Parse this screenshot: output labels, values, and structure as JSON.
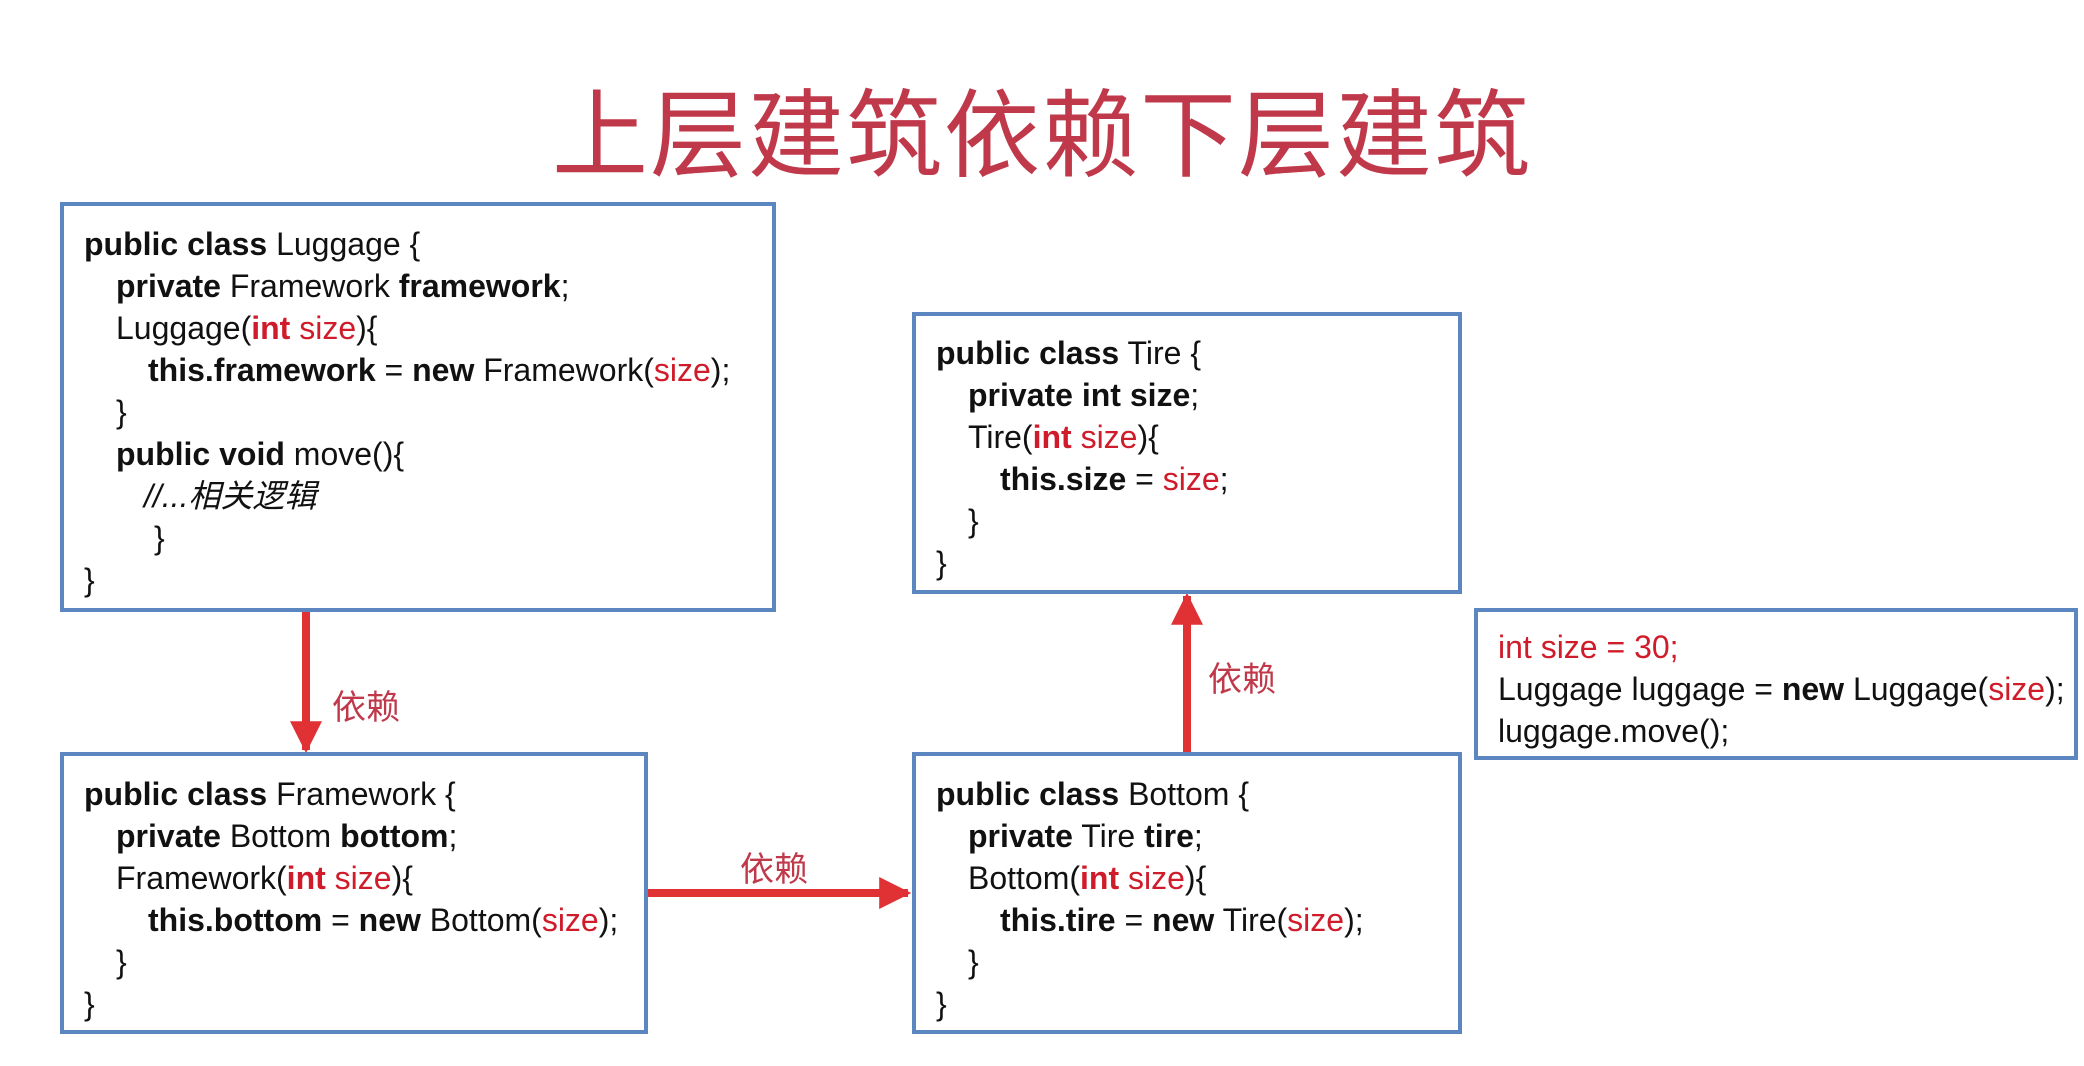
{
  "title": "上层建筑依赖下层建筑",
  "colors": {
    "title": "#c0394b",
    "keyword_red": "#d01c2a",
    "box_border": "#5b86c0",
    "arrow": "#e03134"
  },
  "arrow_label": "依赖",
  "boxes": {
    "luggage": {
      "l1": {
        "a": "public class",
        "b": " Luggage {"
      },
      "l2": {
        "a": "private",
        "b": " Framework ",
        "c": "framework",
        "d": ";"
      },
      "l3": {
        "a": "Luggage(",
        "b": "int",
        "c": " size",
        "d": "){"
      },
      "l4": {
        "a": "this.framework",
        "b": " = ",
        "c": "new",
        "d": " Framework(",
        "e": "size",
        "f": ");"
      },
      "l5": "}",
      "l6": {
        "a": "public void",
        "b": " move(){"
      },
      "l7": "//...相关逻辑",
      "l8": "}",
      "l9": "}"
    },
    "framework": {
      "l1": {
        "a": "public class",
        "b": " Framework {"
      },
      "l2": {
        "a": "private",
        "b": " Bottom ",
        "c": "bottom",
        "d": ";"
      },
      "l3": {
        "a": "Framework(",
        "b": "int",
        "c": " size",
        "d": "){"
      },
      "l4": {
        "a": "this.bottom",
        "b": " = ",
        "c": "new",
        "d": " Bottom(",
        "e": "size",
        "f": ");"
      },
      "l5": "}",
      "l6": "}"
    },
    "tire": {
      "l1": {
        "a": "public class",
        "b": " Tire {"
      },
      "l2": {
        "a": "private int size",
        "b": ";"
      },
      "l3": {
        "a": "Tire(",
        "b": "int",
        "c": " size",
        "d": "){"
      },
      "l4": {
        "a": "this.size",
        "b": " = ",
        "c": "size",
        "d": ";"
      },
      "l5": "}",
      "l6": "}"
    },
    "bottom": {
      "l1": {
        "a": "public class",
        "b": " Bottom {"
      },
      "l2": {
        "a": "private",
        "b": " Tire ",
        "c": "tire",
        "d": ";"
      },
      "l3": {
        "a": "Bottom(",
        "b": "int",
        "c": " size",
        "d": "){"
      },
      "l4": {
        "a": "this.tire",
        "b": " = ",
        "c": "new",
        "d": " Tire(",
        "e": "size",
        "f": ");"
      },
      "l5": "}",
      "l6": "}"
    },
    "main": {
      "l1": {
        "a": "int size = 30;"
      },
      "l2": {
        "a": "Luggage luggage = ",
        "b": "new",
        "c": " Luggage(",
        "d": "size",
        "e": ");"
      },
      "l3": "luggage.move();"
    }
  }
}
